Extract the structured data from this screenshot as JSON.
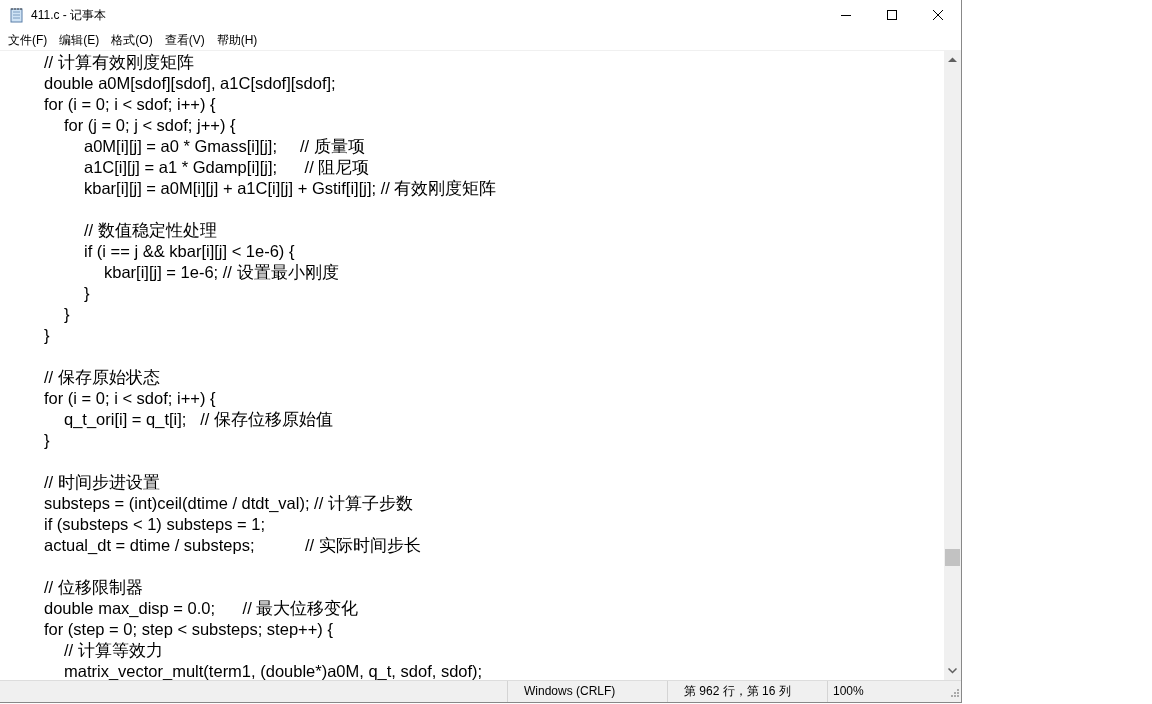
{
  "window": {
    "title": "411.c - 记事本"
  },
  "menu": [
    "文件(F)",
    "编辑(E)",
    "格式(O)",
    "查看(V)",
    "帮助(H)"
  ],
  "editor": {
    "lines": [
      {
        "kind": "code",
        "text": "\t\t// 计算有效刚度矩阵"
      },
      {
        "kind": "code",
        "text": "\t\tdouble a0M[sdof][sdof], a1C[sdof][sdof];"
      },
      {
        "kind": "code",
        "text": "\t\tfor (i = 0; i < sdof; i++) {"
      },
      {
        "kind": "code",
        "text": "\t\t\tfor (j = 0; j < sdof; j++) {"
      },
      {
        "kind": "code",
        "text": "\t\t\t\ta0M[i][j] = a0 * Gmass[i][j];     // 质量项"
      },
      {
        "kind": "code",
        "text": "\t\t\t\ta1C[i][j] = a1 * Gdamp[i][j];      // 阻尼项"
      },
      {
        "kind": "code",
        "text": "\t\t\t\tkbar[i][j] = a0M[i][j] + a1C[i][j] + Gstif[i][j]; // 有效刚度矩阵"
      },
      {
        "kind": "blank"
      },
      {
        "kind": "code",
        "text": "\t\t\t\t// 数值稳定性处理"
      },
      {
        "kind": "code",
        "text": "\t\t\t\tif (i == j && kbar[i][j] < 1e-6) {"
      },
      {
        "kind": "code",
        "text": "\t\t\t\t\tkbar[i][j] = 1e-6; // 设置最小刚度"
      },
      {
        "kind": "code",
        "text": "\t\t\t\t}"
      },
      {
        "kind": "code",
        "text": "\t\t\t}"
      },
      {
        "kind": "code",
        "text": "\t\t}"
      },
      {
        "kind": "blank"
      },
      {
        "kind": "code",
        "text": "\t\t// 保存原始状态"
      },
      {
        "kind": "code",
        "text": "\t\tfor (i = 0; i < sdof; i++) {"
      },
      {
        "kind": "code",
        "text": "\t\t\tq_t_ori[i] = q_t[i];   // 保存位移原始值"
      },
      {
        "kind": "code",
        "text": "\t\t}"
      },
      {
        "kind": "blank"
      },
      {
        "kind": "code",
        "text": "\t\t// 时间步进设置"
      },
      {
        "kind": "code",
        "text": "\t\tsubsteps = (int)ceil(dtime / dtdt_val); // 计算子步数"
      },
      {
        "kind": "code",
        "text": "\t\tif (substeps < 1) substeps = 1;"
      },
      {
        "kind": "code",
        "text": "\t\tactual_dt = dtime / substeps;           // 实际时间步长"
      },
      {
        "kind": "blank"
      },
      {
        "kind": "code",
        "text": "\t\t// 位移限制器"
      },
      {
        "kind": "code",
        "text": "\t\tdouble max_disp = 0.0;      // 最大位移变化"
      },
      {
        "kind": "code",
        "text": "\t\tfor (step = 0; step < substeps; step++) {"
      },
      {
        "kind": "code",
        "text": "\t\t\t// 计算等效力"
      },
      {
        "kind": "code",
        "text": "\t\t\tmatrix_vector_mult(term1, (double*)a0M, q_t, sdof, sdof);"
      }
    ]
  },
  "status_bar": {
    "encoding": "Windows (CRLF)",
    "position": "第 962 行，第 16 列",
    "zoom": "100%"
  }
}
